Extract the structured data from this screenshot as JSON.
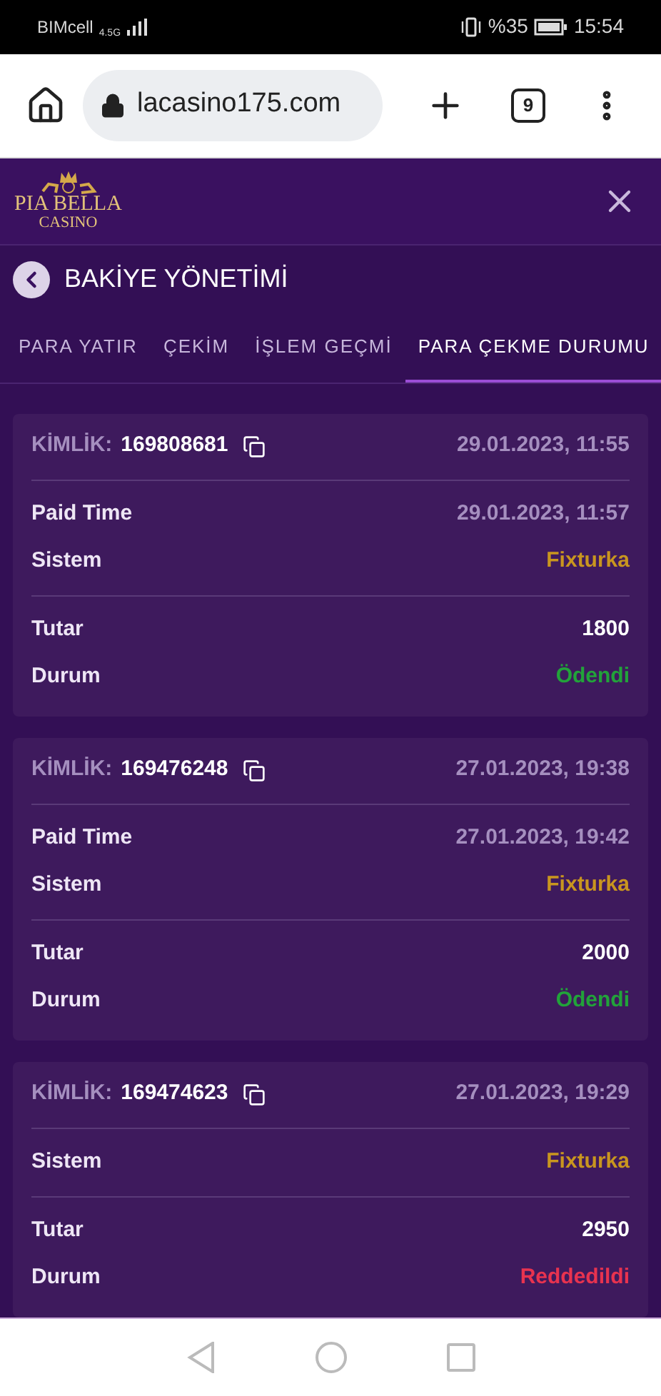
{
  "status_bar": {
    "carrier": "BIMcell",
    "network": "4.5G",
    "battery": "%35",
    "time": "15:54"
  },
  "browser": {
    "url": "lacasino175.com",
    "tab_count": "9"
  },
  "logo": {
    "name": "PIA BELLA",
    "subtitle": "CASINO"
  },
  "page_title": "BAKİYE YÖNETİMİ",
  "tabs": [
    {
      "label": "PARA YATIR",
      "selected": false
    },
    {
      "label": "ÇEKİM",
      "selected": false
    },
    {
      "label": "İŞLEM GEÇMİ",
      "selected": false
    },
    {
      "label": "PARA ÇEKME DURUMU",
      "selected": true
    }
  ],
  "withdrawals": [
    {
      "id_label": "KİMLİK:",
      "id": "169808681",
      "date": "29.01.2023, 11:55",
      "sections": [
        [
          {
            "label": "Paid Time",
            "value": "29.01.2023, 11:57",
            "kind": "date"
          },
          {
            "label": "Sistem",
            "value": "Fixturka",
            "kind": "system"
          }
        ],
        [
          {
            "label": "Tutar",
            "value": "1800",
            "kind": "amount"
          },
          {
            "label": "Durum",
            "value": "Ödendi",
            "kind": "status",
            "color": "#22a33a"
          }
        ]
      ]
    },
    {
      "id_label": "KİMLİK:",
      "id": "169476248",
      "date": "27.01.2023, 19:38",
      "sections": [
        [
          {
            "label": "Paid Time",
            "value": "27.01.2023, 19:42",
            "kind": "date"
          },
          {
            "label": "Sistem",
            "value": "Fixturka",
            "kind": "system"
          }
        ],
        [
          {
            "label": "Tutar",
            "value": "2000",
            "kind": "amount"
          },
          {
            "label": "Durum",
            "value": "Ödendi",
            "kind": "status",
            "color": "#22a33a"
          }
        ]
      ]
    },
    {
      "id_label": "KİMLİK:",
      "id": "169474623",
      "date": "27.01.2023, 19:29",
      "sections": [
        [
          {
            "label": "Sistem",
            "value": "Fixturka",
            "kind": "system"
          }
        ],
        [
          {
            "label": "Tutar",
            "value": "2950",
            "kind": "amount"
          },
          {
            "label": "Durum",
            "value": "Reddedildi",
            "kind": "status",
            "color": "#e8334f"
          }
        ]
      ]
    }
  ]
}
